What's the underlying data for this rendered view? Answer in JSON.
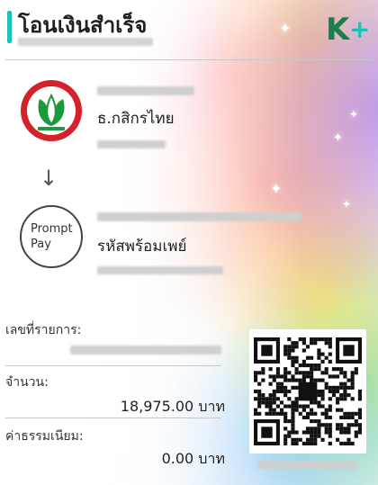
{
  "header": {
    "title": "โอนเงินสำเร็จ",
    "logo_letter": "K",
    "logo_plus": "+"
  },
  "sender": {
    "bank_name": "ธ.กสิกรไทย",
    "logo_icon": "kasikorn-bank-icon"
  },
  "receiver": {
    "service_name": "รหัสพร้อมเพย์",
    "logo_line1": "Prompt",
    "logo_line2": "Pay"
  },
  "details": {
    "reference_label": "เลขที่รายการ:",
    "amount_label": "จำนวน:",
    "amount_value": "18,975.00 บาท",
    "fee_label": "ค่าธรรมเนียม:",
    "fee_value": "0.00 บาท"
  },
  "colors": {
    "accent": "#18c3b6",
    "kbank_green": "#1a9a3b",
    "kbank_red": "#d6202a"
  }
}
